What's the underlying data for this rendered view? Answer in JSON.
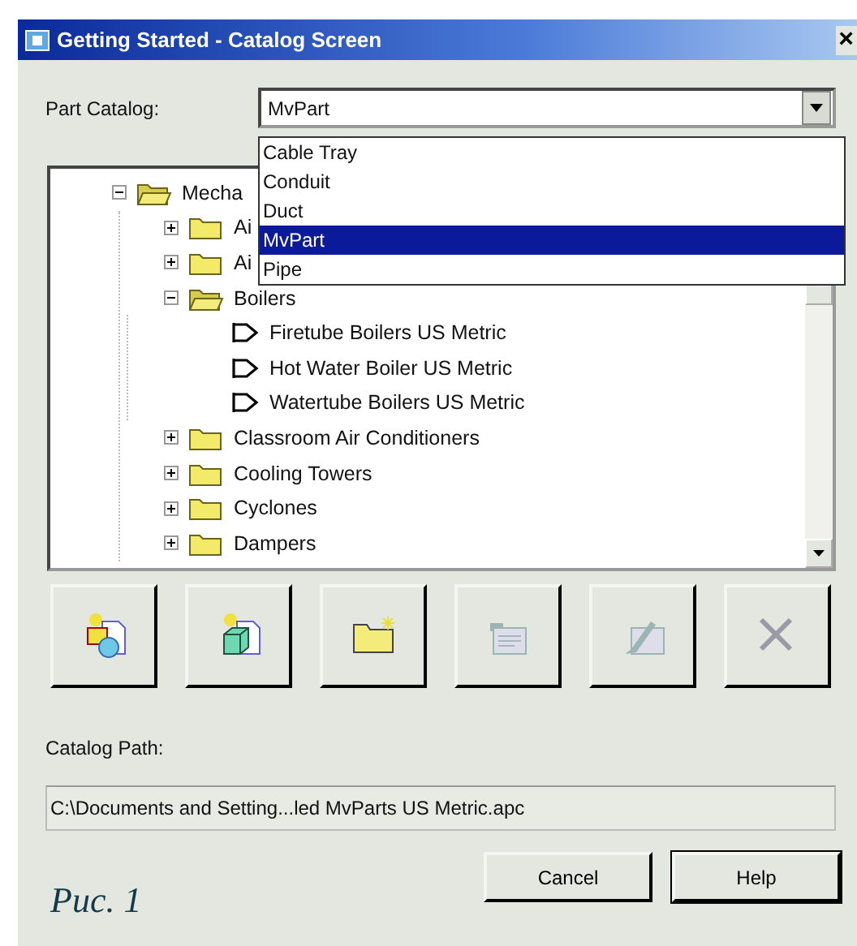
{
  "window": {
    "title": "Getting Started - Catalog Screen",
    "close": "×"
  },
  "part_catalog": {
    "label": "Part Catalog:",
    "value": "MvPart",
    "expanded": true,
    "options": [
      {
        "label": "Cable Tray",
        "selected": false
      },
      {
        "label": "Conduit",
        "selected": false
      },
      {
        "label": "Duct",
        "selected": false
      },
      {
        "label": "MvPart",
        "selected": true
      },
      {
        "label": "Pipe",
        "selected": false
      }
    ]
  },
  "tree": [
    {
      "label": "Mecha",
      "kind": "folder",
      "expanded": true,
      "children": [
        {
          "label": "Ai",
          "kind": "folder",
          "expanded": false
        },
        {
          "label": "Ai",
          "kind": "folder",
          "expanded": false
        },
        {
          "label": "Boilers",
          "kind": "folder",
          "expanded": true,
          "children": [
            {
              "label": "Firetube Boilers US Metric",
              "kind": "part"
            },
            {
              "label": "Hot Water Boiler US Metric",
              "kind": "part"
            },
            {
              "label": "Watertube Boilers US Metric",
              "kind": "part"
            }
          ]
        },
        {
          "label": "Classroom Air Conditioners",
          "kind": "folder",
          "expanded": false
        },
        {
          "label": "Cooling Towers",
          "kind": "folder",
          "expanded": false
        },
        {
          "label": "Cyclones",
          "kind": "folder",
          "expanded": false
        },
        {
          "label": "Dampers",
          "kind": "folder",
          "expanded": false
        }
      ]
    }
  ],
  "toolbar": [
    {
      "kind": "new-catalog",
      "disabled": false
    },
    {
      "kind": "new-part",
      "disabled": false
    },
    {
      "kind": "new-folder",
      "disabled": false
    },
    {
      "kind": "new-item",
      "disabled": true
    },
    {
      "kind": "edit",
      "disabled": true
    },
    {
      "kind": "delete",
      "disabled": true
    }
  ],
  "catalog_path": {
    "label": "Catalog Path:",
    "value": "C:\\Documents and Setting...led MvParts US Metric.apc"
  },
  "buttons": [
    {
      "label": "Cancel",
      "default": false
    },
    {
      "label": "Help",
      "default": true
    }
  ],
  "caption": "Рис. 1"
}
